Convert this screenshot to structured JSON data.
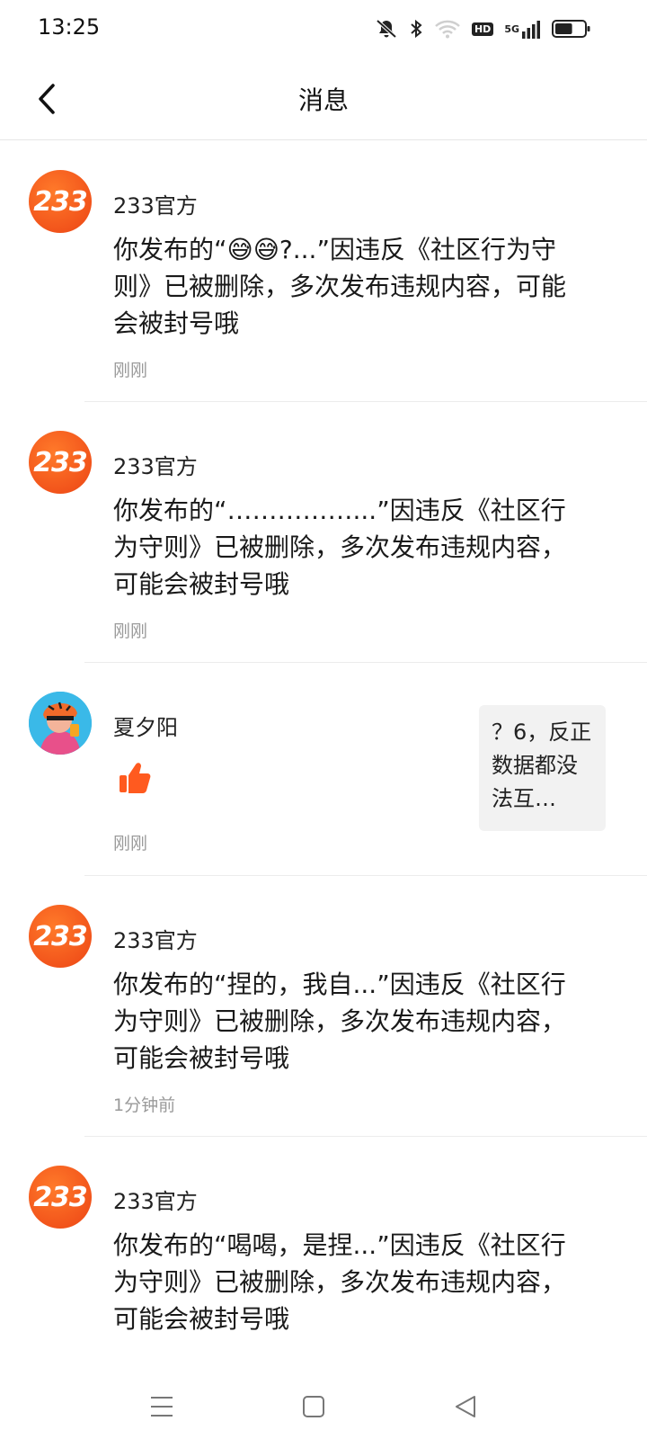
{
  "status_bar": {
    "time": "13:25",
    "icons": [
      "mute-icon",
      "bluetooth-icon",
      "wifi-icon",
      "hd-icon",
      "signal-5g-icon",
      "battery-icon"
    ],
    "hd_label": "HD",
    "net_label": "5G",
    "battery_level": 0.6
  },
  "header": {
    "title": "消息",
    "back_icon": "chevron-left-icon"
  },
  "messages": [
    {
      "sender": "233官方",
      "avatar_text": "233",
      "body": "你发布的“😅😅?...”因违反《社区行为守则》已被删除，多次发布违规内容，可能会被封号哦",
      "time": "刚刚"
    },
    {
      "sender": "233官方",
      "avatar_text": "233",
      "body": "你发布的“……………...”因违反《社区行为守则》已被删除，多次发布违规内容，可能会被封号哦",
      "time": "刚刚"
    },
    {
      "sender": "夏夕阳",
      "avatar_text": "",
      "body": "",
      "reaction_icon": "thumbs-up-icon",
      "quote": "？6，反正数据都没法互…",
      "time": "刚刚"
    },
    {
      "sender": "233官方",
      "avatar_text": "233",
      "body": "你发布的“捏的，我自...”因违反《社区行为守则》已被删除，多次发布违规内容，可能会被封号哦",
      "time": "1分钟前"
    },
    {
      "sender": "233官方",
      "avatar_text": "233",
      "body": "你发布的“喝喝，是捏...”因违反《社区行为守则》已被删除，多次发布违规内容，可能会被封号哦",
      "time": ""
    }
  ],
  "colors": {
    "brand_orange": "#f2541b",
    "thumb_orange": "#ff5a1f",
    "timestamp_gray": "#9a9a9a",
    "quote_bg": "#f2f2f2"
  },
  "nav_bar": {
    "icons": [
      "menu-icon",
      "home-square-icon",
      "back-triangle-icon"
    ]
  }
}
